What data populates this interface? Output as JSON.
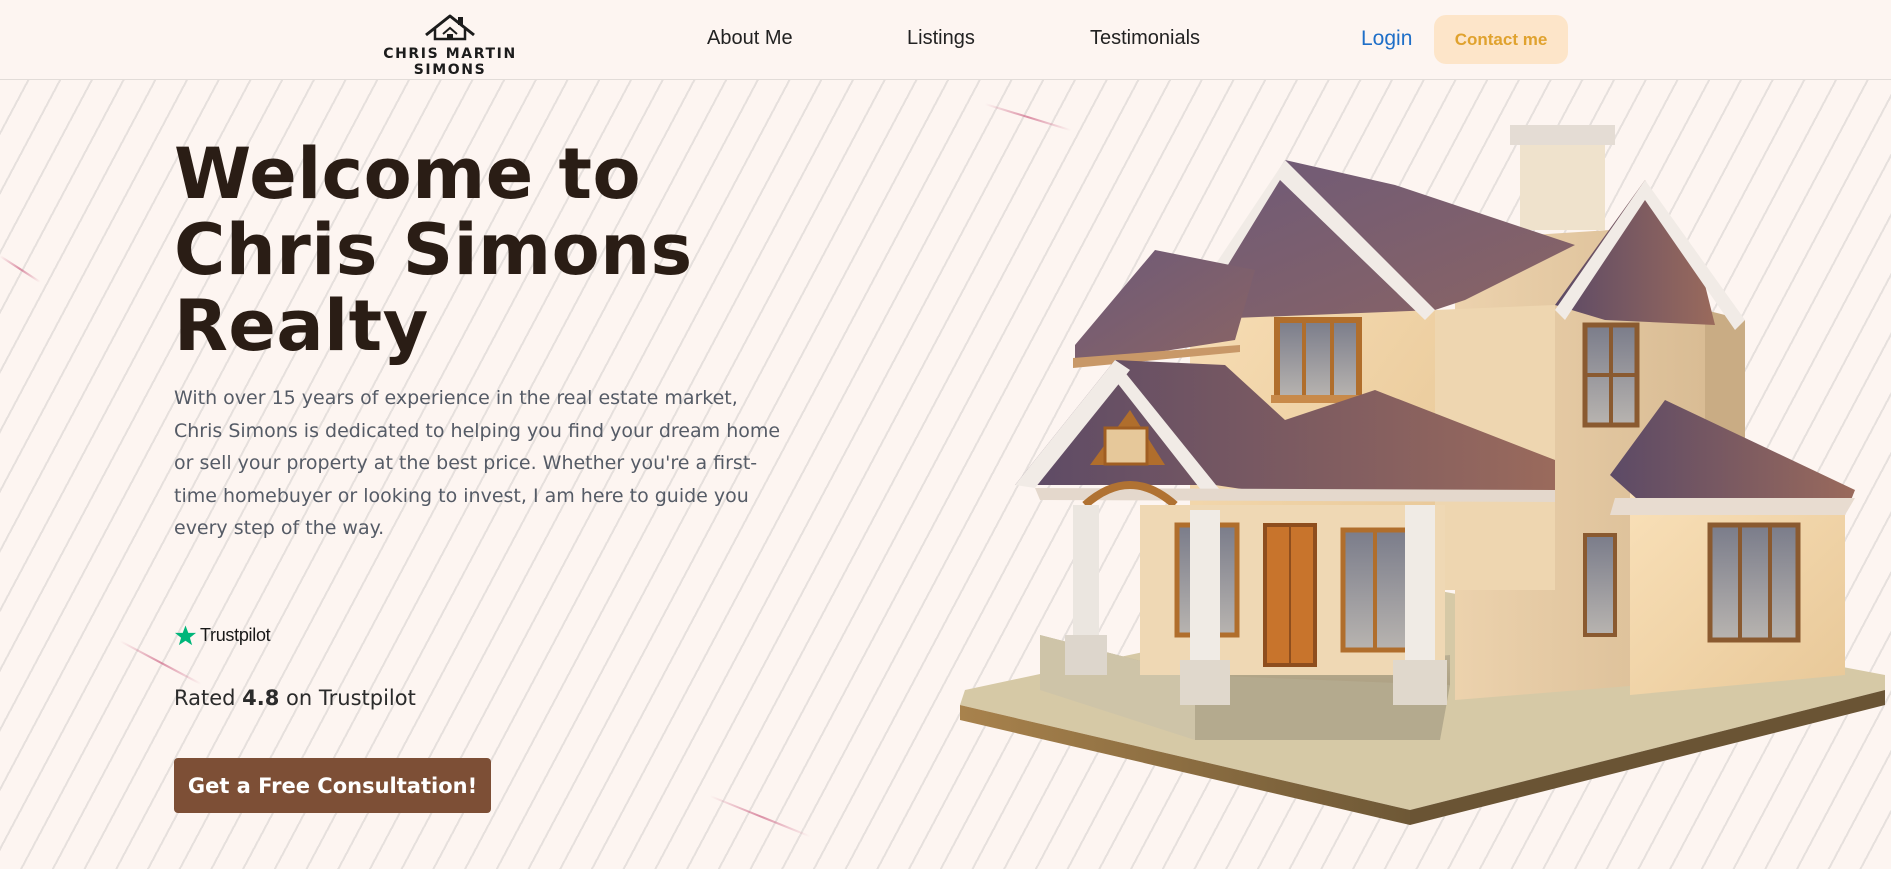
{
  "brand": {
    "name": "CHRIS MARTIN SIMONS",
    "logo_icon": "house-roof-icon"
  },
  "nav": {
    "items": [
      {
        "label": "About Me"
      },
      {
        "label": "Listings"
      },
      {
        "label": "Testimonials"
      }
    ],
    "login_label": "Login",
    "contact_label": "Contact me"
  },
  "hero": {
    "title_lines": [
      "Welcome to",
      "Chris Simons",
      "Realty"
    ],
    "description": "With over 15 years of experience in the real estate market, Chris Simons is dedicated to helping you find your dream home or sell your property at the best price. Whether you're a first-time homebuyer or looking to invest, I am here to guide you every step of the way.",
    "trustpilot": {
      "brand": "Trustpilot",
      "icon": "trustpilot-star-icon",
      "star_color": "#00b67a"
    },
    "rating": {
      "prefix": "Rated ",
      "value": "4.8",
      "suffix": " on Trustpilot"
    },
    "cta_label": "Get a Free Consultation!",
    "image": "3d-house-illustration"
  },
  "colors": {
    "background": "#fdf5f1",
    "title": "#2a1d15",
    "cta": "#7d4f36",
    "contact_bg": "#fde5c9",
    "contact_text": "#e0a22e",
    "login": "#1f6fc8"
  }
}
